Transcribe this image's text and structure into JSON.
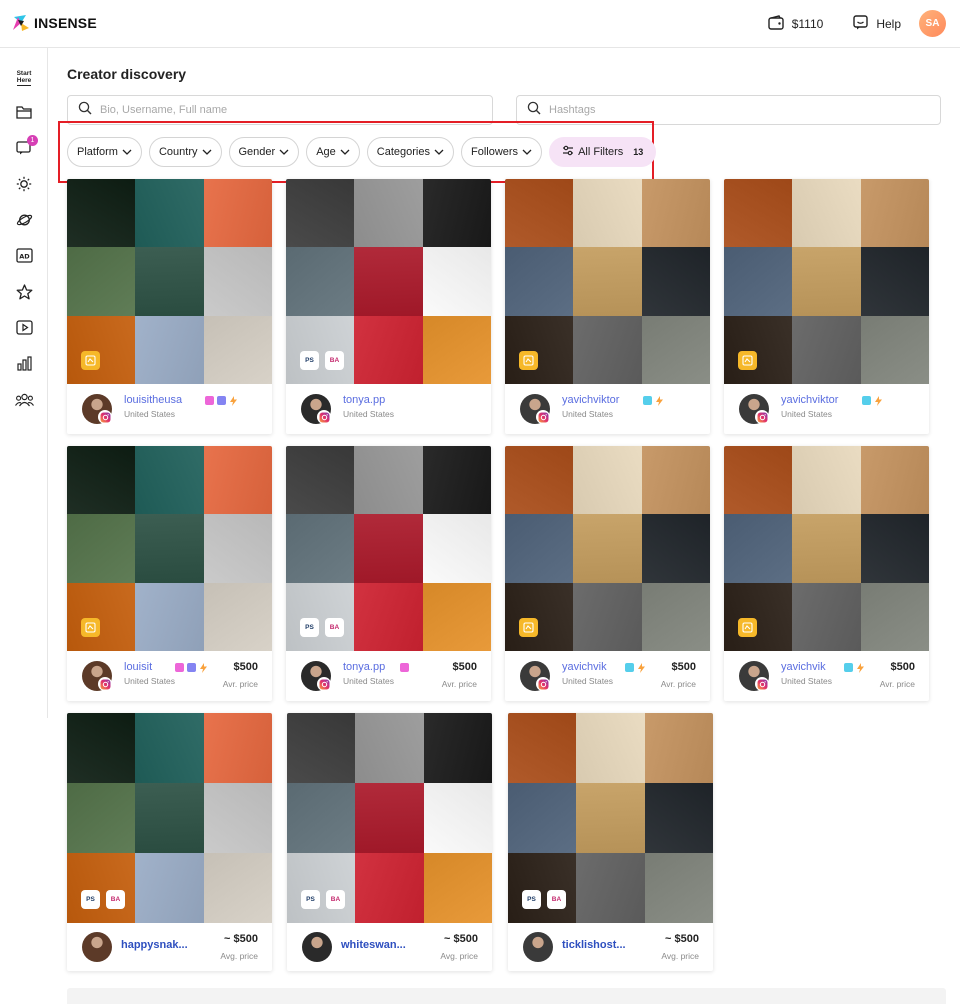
{
  "app": {
    "name": "INSENSE"
  },
  "header": {
    "balance": "$1110",
    "help_label": "Help",
    "user_initials": "SA"
  },
  "sidebar": {
    "start_here": [
      "Start",
      "Here"
    ],
    "notification_count": "1",
    "items": [
      "start-here",
      "folder",
      "messages",
      "brightness",
      "planet",
      "ad",
      "star",
      "video",
      "chart",
      "users"
    ]
  },
  "page": {
    "title": "Creator discovery"
  },
  "search": {
    "bio_placeholder": "Bio, Username, Full name",
    "hashtags_placeholder": "Hashtags"
  },
  "filters": {
    "chips": [
      "Platform",
      "Country",
      "Gender",
      "Age",
      "Categories",
      "Followers"
    ],
    "all_filters_label": "All Filters",
    "all_filters_count": "13"
  },
  "colors": {
    "accent": "#5a6de0",
    "highlight_box": "#e41e26",
    "all_filters_bg": "#f6e3f6",
    "badge_gold": "#f6b829"
  },
  "creators": {
    "row1": [
      {
        "name": "louisitheusa",
        "country": "United States",
        "mosaic": "A",
        "tags": [
          "gold"
        ],
        "badges": [
          "#ea4bd1",
          "#6f6ff0",
          "#f9a23d"
        ]
      },
      {
        "name": "tonya.pp",
        "country": "United States",
        "mosaic": "B",
        "tags": [
          "PS",
          "BA"
        ],
        "badges": []
      },
      {
        "name": "yavichviktor",
        "country": "United States",
        "mosaic": "C",
        "tags": [
          "gold"
        ],
        "badges": [
          "#37c5e8",
          "#f9a23d"
        ]
      },
      {
        "name": "yavichviktor",
        "country": "United States",
        "mosaic": "C",
        "tags": [
          "gold"
        ],
        "badges": [
          "#37c5e8",
          "#f9a23d"
        ]
      }
    ],
    "row2": [
      {
        "name": "louisit",
        "country": "United States",
        "price": "$500",
        "price_label": "Avr. price",
        "mosaic": "A",
        "tags": [
          "gold"
        ],
        "badges": [
          "#ea4bd1",
          "#6f6ff0",
          "#f9a23d"
        ]
      },
      {
        "name": "tonya.pp",
        "country": "United States",
        "price": "$500",
        "price_label": "Avr. price",
        "mosaic": "B",
        "tags": [
          "PS",
          "BA"
        ],
        "badges": [
          "#ea4bd1"
        ]
      },
      {
        "name": "yavichvik",
        "country": "United States",
        "price": "$500",
        "price_label": "Avr. price",
        "mosaic": "C",
        "tags": [
          "gold"
        ],
        "badges": [
          "#37c5e8",
          "#f9a23d"
        ]
      },
      {
        "name": "yavichvik",
        "country": "United States",
        "price": "$500",
        "price_label": "Avr. price",
        "mosaic": "C",
        "tags": [
          "gold"
        ],
        "badges": [
          "#37c5e8",
          "#f9a23d"
        ]
      }
    ],
    "row3": [
      {
        "name": "happysnak...",
        "price": "~ $500",
        "price_label": "Avg. price",
        "mosaic": "A",
        "tags": [
          "PS",
          "BA"
        ]
      },
      {
        "name": "whiteswan...",
        "price": "~ $500",
        "price_label": "Avg. price",
        "mosaic": "B",
        "tags": [
          "PS",
          "BA"
        ]
      },
      {
        "name": "ticklishost...",
        "price": "~ $500",
        "price_label": "Avg. price",
        "mosaic": "C",
        "tags": [
          "PS",
          "BA"
        ]
      }
    ]
  },
  "mosaics": {
    "A": [
      "#1f2e24",
      "#1e5a55",
      "#e8734d",
      "#4e6b45",
      "#3c5e52",
      "#b8b8b8",
      "#c96a1e",
      "#8fa0b8",
      "#d8d2c8"
    ],
    "B": [
      "#4a4a4a",
      "#8c8c8c",
      "#2a2a2a",
      "#5a6a72",
      "#b12a3a",
      "#e8e8e8",
      "#cfd3d6",
      "#c0202e",
      "#e89a3a"
    ],
    "C": [
      "#b05a2a",
      "#d8cab0",
      "#c89a6a",
      "#4a5c72",
      "#c8a46a",
      "#1e2328",
      "#3a3028",
      "#5a5a5a",
      "#8a8e86"
    ]
  }
}
